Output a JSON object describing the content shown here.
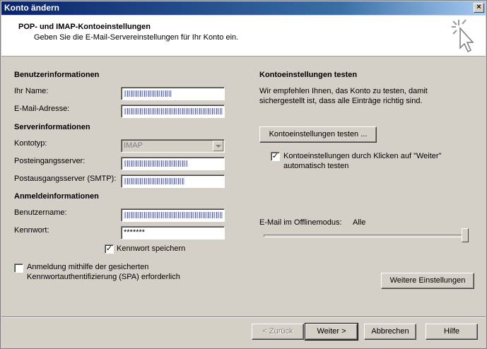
{
  "window": {
    "title": "Konto ändern",
    "close_glyph": "×"
  },
  "header": {
    "title": "POP- und IMAP-Kontoeinstellungen",
    "subtitle": "Geben Sie die E-Mail-Servereinstellungen für Ihr Konto ein.",
    "icon": "cursor-sparkle-icon"
  },
  "left": {
    "user_section": "Benutzerinformationen",
    "name_label": "Ihr Name:",
    "email_label": "E-Mail-Adresse:",
    "server_section": "Serverinformationen",
    "account_type_label": "Kontotyp:",
    "account_type_value": "IMAP",
    "incoming_label": "Posteingangsserver:",
    "outgoing_label": "Postausgangsserver (SMTP):",
    "login_section": "Anmeldeinformationen",
    "username_label": "Benutzername:",
    "password_label": "Kennwort:",
    "password_value": "*******",
    "remember_password_label": "Kennwort speichern",
    "remember_password_checked": true,
    "spa_label_line1": "Anmeldung mithilfe der gesicherten",
    "spa_label_line2": "Kennwortauthentifizierung (SPA) erforderlich",
    "spa_checked": false
  },
  "right": {
    "test_section": "Kontoeinstellungen testen",
    "test_desc_line1": "Wir empfehlen Ihnen, das Konto zu testen, damit",
    "test_desc_line2": "sichergestellt ist, dass alle Einträge richtig sind.",
    "test_button": "Kontoeinstellungen testen ...",
    "auto_test_line1": "Kontoeinstellungen durch Klicken auf \"Weiter\"",
    "auto_test_line2": "automatisch testen",
    "auto_test_checked": true,
    "offline_label": "E-Mail im Offlinemodus:",
    "offline_value": "Alle",
    "offline_slider_fraction": 1.0,
    "more_settings_button": "Weitere Einstellungen"
  },
  "footer": {
    "back": "< Zurück",
    "next": "Weiter >",
    "cancel": "Abbrechen",
    "help": "Hilfe"
  }
}
